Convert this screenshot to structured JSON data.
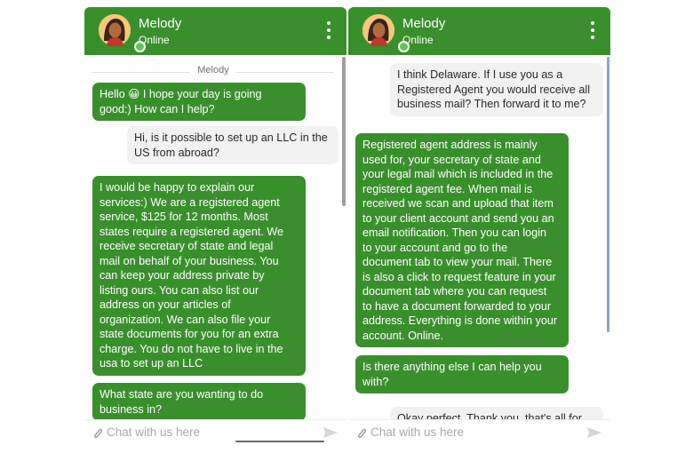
{
  "colors": {
    "brand_green": "#3a8f2d",
    "online_dot": "#5cc45a",
    "user_bubble": "#f1f1f1"
  },
  "left_widget": {
    "header": {
      "name": "Melody",
      "status": "Online",
      "avatar_icon": "agent-avatar-icon",
      "menu_icon": "kebab-menu-icon"
    },
    "separator": "Melody",
    "messages": [
      {
        "from": "agent",
        "text": "Hello 😀 I hope your day is going\ngood:) How can I help?"
      },
      {
        "from": "user",
        "text": "Hi, is it possible to set up an LLC in the\nUS from abroad?"
      },
      {
        "from": "agent",
        "text": "I would be happy to explain our\nservices:) We are a registered agent\nservice, $125 for 12 months. Most\nstates require a registered agent. We\nreceive secretary of state and legal\nmail on behalf of your business. You\ncan keep your address private by\nlisting ours. You can also list our\naddress on your articles of\norganization. We can also file your\nstate documents for you for an extra\ncharge. You do not have to live in the\nusa to set up an LLC"
      },
      {
        "from": "agent",
        "text": "What state are you wanting to do\nbusiness in?"
      }
    ],
    "composer": {
      "placeholder": "Chat with us here",
      "attach_icon": "paperclip-icon",
      "send_icon": "send-icon"
    }
  },
  "right_widget": {
    "header": {
      "name": "Melody",
      "status": "Online",
      "avatar_icon": "agent-avatar-icon",
      "menu_icon": "kebab-menu-icon"
    },
    "messages": [
      {
        "from": "user",
        "text": "I think Delaware. If I use you as a\nRegistered Agent you would receive all\nbusiness mail? Then forward it to me?"
      },
      {
        "from": "agent",
        "text": "Registered agent address is mainly\nused for, your secretary of state and\nyour legal mail which is included in the\nregistered agent fee. When mail is\nreceived we scan and upload that item\nto your client account and send you an\nemail notification. Then you can login\nto your account and go to the\ndocument tab to view your mail. There\nis also a click to request feature in your\ndocument tab where you can request\nto have a document forwarded to your\naddress. Everything is done within your\naccount. Online."
      },
      {
        "from": "agent",
        "text": "Is there anything else I can help you\nwith?"
      },
      {
        "from": "user",
        "text": "Okay perfect. Thank you, that's all for"
      }
    ],
    "composer": {
      "placeholder": "Chat with us here",
      "attach_icon": "paperclip-icon",
      "send_icon": "send-icon"
    }
  }
}
